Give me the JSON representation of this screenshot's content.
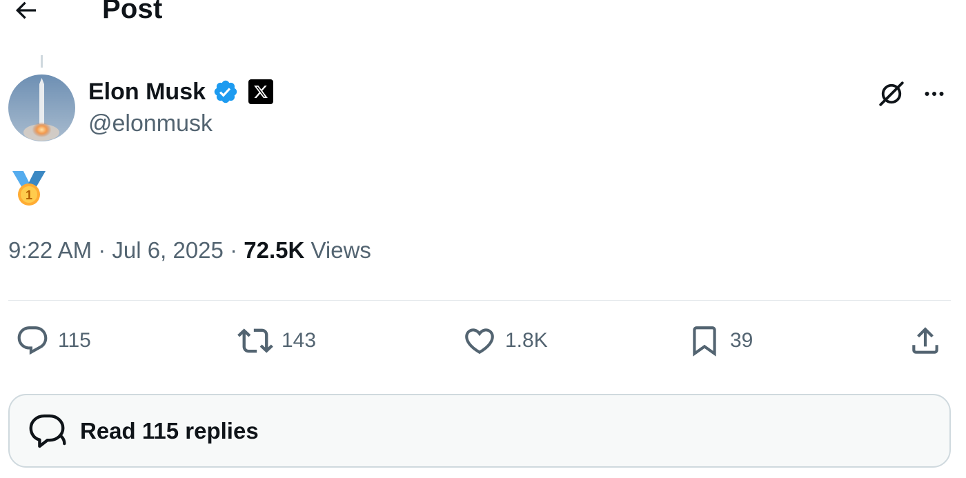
{
  "header": {
    "title": "Post",
    "back_icon": "arrow-left-icon"
  },
  "author": {
    "name": "Elon Musk",
    "handle": "@elonmusk",
    "verified": true,
    "verified_color": "#1d9bf0",
    "affiliation_badge_icon": "x-logo-icon"
  },
  "post": {
    "content_emoji": "🥇",
    "content_icon": "first-place-medal-icon",
    "time": "9:22 AM",
    "separator": "·",
    "date": "Jul 6, 2025",
    "views_count": "72.5K",
    "views_label": "Views"
  },
  "actions": {
    "replies": "115",
    "reposts": "143",
    "likes": "1.8K",
    "bookmarks": "39"
  },
  "read_replies": {
    "label": "Read 115 replies"
  },
  "colors": {
    "text": "#0f1419",
    "secondary": "#536471",
    "accent": "#1d9bf0",
    "border": "#cfd9de"
  }
}
